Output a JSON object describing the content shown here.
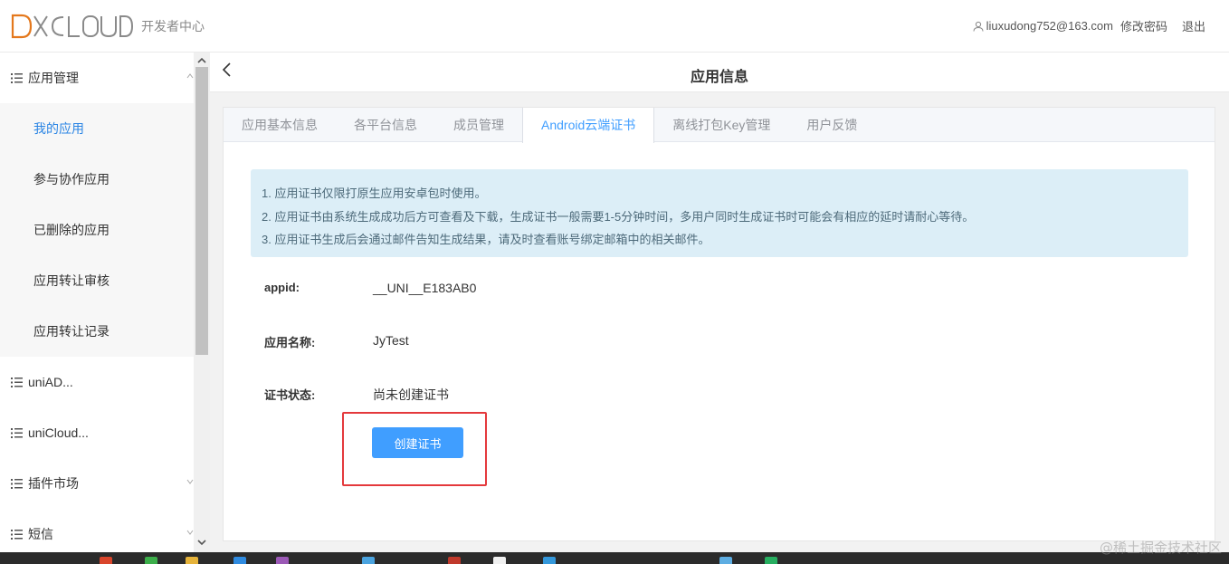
{
  "header": {
    "brand_sub": "开发者中心",
    "user_email": "liuxudong752@163.com",
    "change_password": "修改密码",
    "logout": "退出"
  },
  "sidebar": {
    "groups": [
      {
        "label": "应用管理"
      },
      {
        "label": "uniAD..."
      },
      {
        "label": "uniCloud..."
      },
      {
        "label": "插件市场"
      },
      {
        "label": "短信"
      }
    ],
    "sub_items": [
      {
        "label": "我的应用"
      },
      {
        "label": "参与协作应用"
      },
      {
        "label": "已删除的应用"
      },
      {
        "label": "应用转让审核"
      },
      {
        "label": "应用转让记录"
      }
    ]
  },
  "main": {
    "title": "应用信息",
    "tabs": [
      {
        "label": "应用基本信息"
      },
      {
        "label": "各平台信息"
      },
      {
        "label": "成员管理"
      },
      {
        "label": "Android云端证书"
      },
      {
        "label": "离线打包Key管理"
      },
      {
        "label": "用户反馈"
      }
    ],
    "notice": [
      "1. 应用证书仅限打原生应用安卓包时使用。",
      "2. 应用证书由系统生成成功后方可查看及下载，生成证书一般需要1-5分钟时间，多用户同时生成证书时可能会有相应的延时请耐心等待。",
      "3. 应用证书生成后会通过邮件告知生成结果，请及时查看账号绑定邮箱中的相关邮件。"
    ],
    "fields": {
      "appid_label": "appid:",
      "appid_value": "__UNI__E183AB0",
      "name_label": "应用名称:",
      "name_value": "JyTest",
      "status_label": "证书状态:",
      "status_value": "尚未创建证书"
    },
    "create_button": "创建证书"
  },
  "watermark": "@稀土掘金技术社区",
  "colors": {
    "accent": "#409eff",
    "active_link": "#2b85e4",
    "notice_bg": "#dceef7",
    "highlight": "#e4393c"
  }
}
